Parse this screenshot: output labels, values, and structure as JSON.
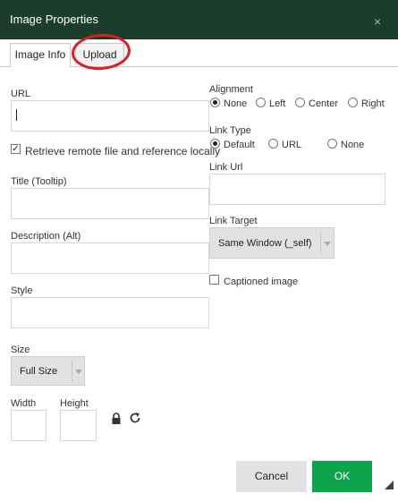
{
  "dialog": {
    "title": "Image Properties",
    "close_glyph": "×"
  },
  "tabs": [
    {
      "label": "Image Info",
      "active": true
    },
    {
      "label": "Upload",
      "active": false
    }
  ],
  "url": {
    "label": "URL",
    "value": ""
  },
  "retrieve": {
    "label": "Retrieve remote file and reference locally",
    "checked": true,
    "glyph": "✓"
  },
  "title_tooltip": {
    "label": "Title (Tooltip)",
    "value": ""
  },
  "description": {
    "label": "Description (Alt)",
    "value": ""
  },
  "style": {
    "label": "Style",
    "value": ""
  },
  "size": {
    "label": "Size",
    "selected": "Full Size"
  },
  "width": {
    "label": "Width",
    "value": ""
  },
  "height": {
    "label": "Height",
    "value": ""
  },
  "icons": {
    "lock": "lock-icon",
    "refresh": "refresh-icon"
  },
  "alignment": {
    "label": "Alignment",
    "options": [
      "None",
      "Left",
      "Center",
      "Right"
    ],
    "selected": "None"
  },
  "link_type": {
    "label": "Link Type",
    "options": [
      "Default",
      "URL",
      "None"
    ],
    "selected": "Default"
  },
  "link_url": {
    "label": "Link Url",
    "value": ""
  },
  "link_target": {
    "label": "Link Target",
    "selected": "Same Window (_self)"
  },
  "captioned": {
    "label": "Captioned image",
    "checked": false
  },
  "buttons": {
    "cancel": "Cancel",
    "ok": "OK"
  },
  "colors": {
    "titlebar": "#1c3d2c",
    "ok": "#0ea34d",
    "highlight": "#d81e27"
  }
}
